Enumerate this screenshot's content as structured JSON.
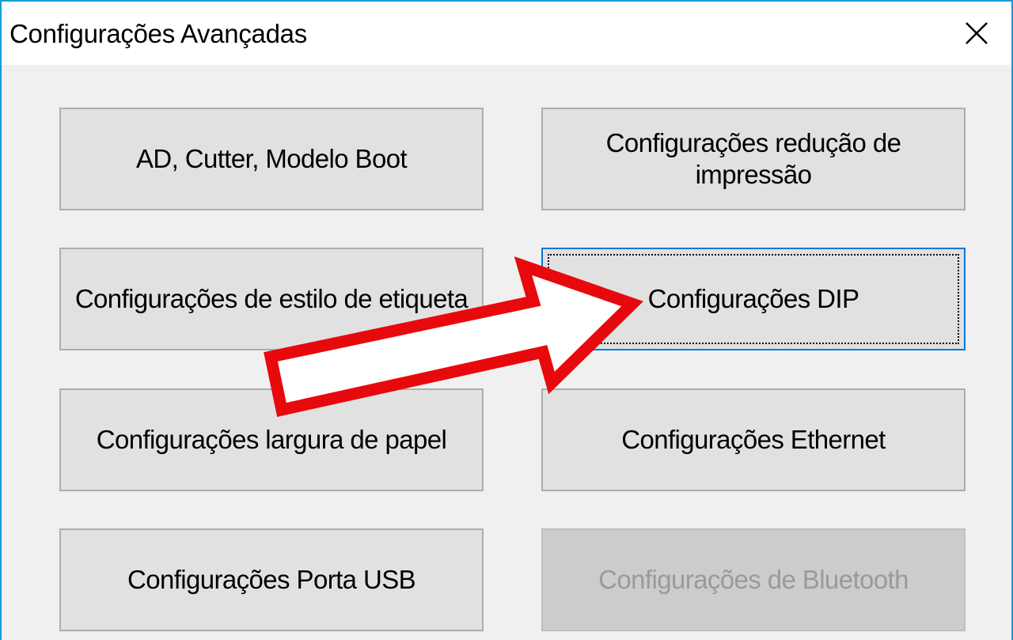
{
  "window": {
    "title": "Configurações Avançadas",
    "close_icon": "close-icon"
  },
  "buttons": {
    "ad_cutter_boot": "AD, Cutter, Modelo Boot",
    "print_reduction": "Configurações redução de impressão",
    "label_style": "Configurações de estilo de etiqueta",
    "dip": "Configurações DIP",
    "paper_width": "Configurações largura de papel",
    "ethernet": "Configurações Ethernet",
    "usb_port": "Configurações Porta USB",
    "bluetooth": "Configurações de Bluetooth"
  },
  "annotation": {
    "icon": "arrow-right-icon",
    "color": "#e8090c"
  },
  "colors": {
    "window_border": "#1a9ad8",
    "focus_border": "#0078d7",
    "button_face": "#e1e1e1",
    "disabled_text": "#9a9a9a"
  }
}
